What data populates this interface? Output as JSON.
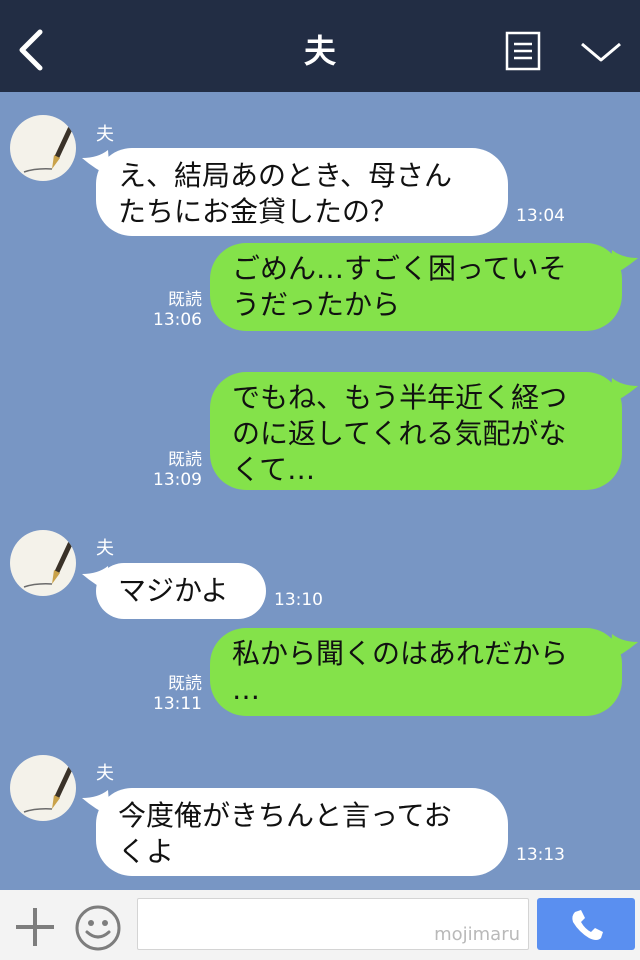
{
  "header": {
    "title": "夫"
  },
  "messages": [
    {
      "sender": "夫",
      "text": "え、結局あのとき、母さん\nたちにお金貸したの？",
      "time": "13:04"
    },
    {
      "text": "ごめん…すごく困っていそ\nうだったから",
      "read": "既読",
      "time": "13:06"
    },
    {
      "text": "でもね、もう半年近く経つ\nのに返してくれる気配がな\nくて…",
      "read": "既読",
      "time": "13:09"
    },
    {
      "sender": "夫",
      "text": "マジかよ",
      "time": "13:10"
    },
    {
      "text": "私から聞くのはあれだから\n…",
      "read": "既読",
      "time": "13:11"
    },
    {
      "sender": "夫",
      "text": "今度俺がきちんと言ってお\nくよ",
      "time": "13:13"
    }
  ],
  "input": {
    "watermark": "mojimaru"
  },
  "icons": {
    "back": "chevron-left-icon",
    "menu": "menu-icon",
    "collapse": "chevron-down-icon",
    "avatar": "pen-avatar-icon",
    "add": "plus-icon",
    "emoji": "smiley-icon",
    "call": "phone-icon"
  },
  "colors": {
    "header": "#222d44",
    "chat_bg": "#7896c4",
    "incoming": "#ffffff",
    "outgoing": "#84e24a",
    "call_button": "#5a8ff0"
  }
}
